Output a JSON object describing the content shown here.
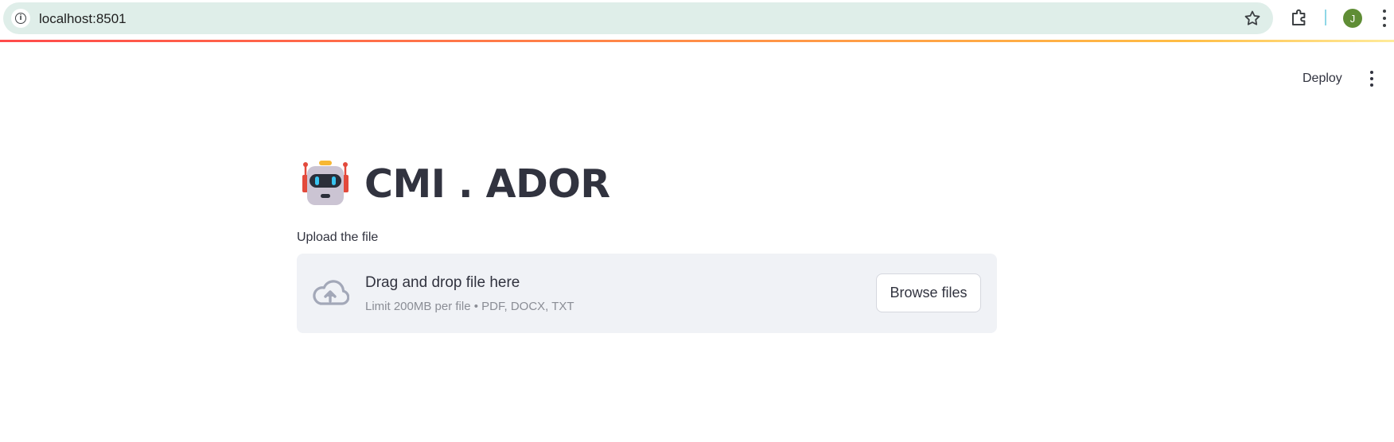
{
  "browser": {
    "url": "localhost:8501",
    "info_icon": "info-icon",
    "profile_initial": "J",
    "profile_color": "#5f8d35"
  },
  "header": {
    "deploy_label": "Deploy",
    "menu_icon": "more-vertical-icon"
  },
  "main": {
    "title_icon": "robot-emoji-icon",
    "title": "CMI . ADOR",
    "uploader": {
      "label": "Upload the file",
      "drop_title": "Drag and drop file here",
      "drop_subtitle": "Limit 200MB per file • PDF, DOCX, TXT",
      "browse_label": "Browse files",
      "icon": "cloud-upload-icon"
    }
  },
  "colors": {
    "accent_gradient": [
      "#ff4b4b",
      "#ffbd45",
      "#ffeb9a"
    ],
    "dropzone_bg": "#f0f2f6",
    "text": "#31333f"
  }
}
